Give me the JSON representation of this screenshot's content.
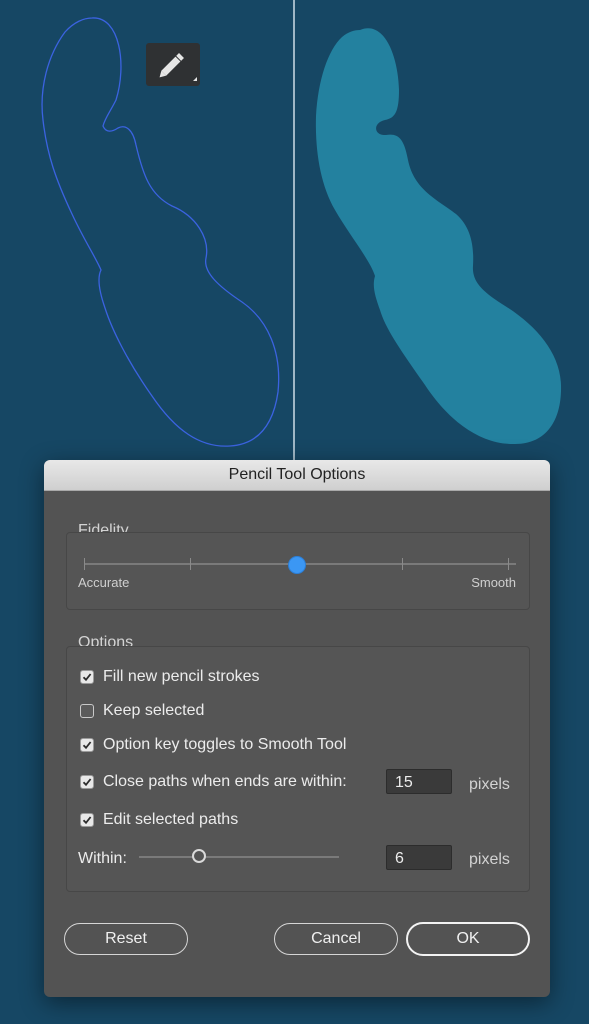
{
  "canvas": {
    "background": "#164764",
    "outline_color": "#3b63e0",
    "fill_color": "#23819f",
    "cursor_icon": "pencil-icon"
  },
  "dialog": {
    "title": "Pencil Tool Options",
    "fidelity": {
      "label": "Fidelity",
      "min_label": "Accurate",
      "max_label": "Smooth",
      "value": 0.5,
      "accent": "#3b97f4"
    },
    "options": {
      "label": "Options",
      "fill_new_strokes": {
        "label": "Fill new pencil strokes",
        "checked": true
      },
      "keep_selected": {
        "label": "Keep selected",
        "checked": false
      },
      "option_key_toggle": {
        "label": "Option key toggles to Smooth Tool",
        "checked": true
      },
      "close_paths": {
        "label": "Close paths when ends are within:",
        "checked": true,
        "value": "15",
        "unit": "pixels"
      },
      "edit_selected": {
        "label": "Edit selected paths",
        "checked": true
      },
      "within": {
        "label": "Within:",
        "value": "6",
        "unit": "pixels",
        "slider_value": 0.25
      }
    },
    "buttons": {
      "reset": "Reset",
      "cancel": "Cancel",
      "ok": "OK"
    }
  }
}
